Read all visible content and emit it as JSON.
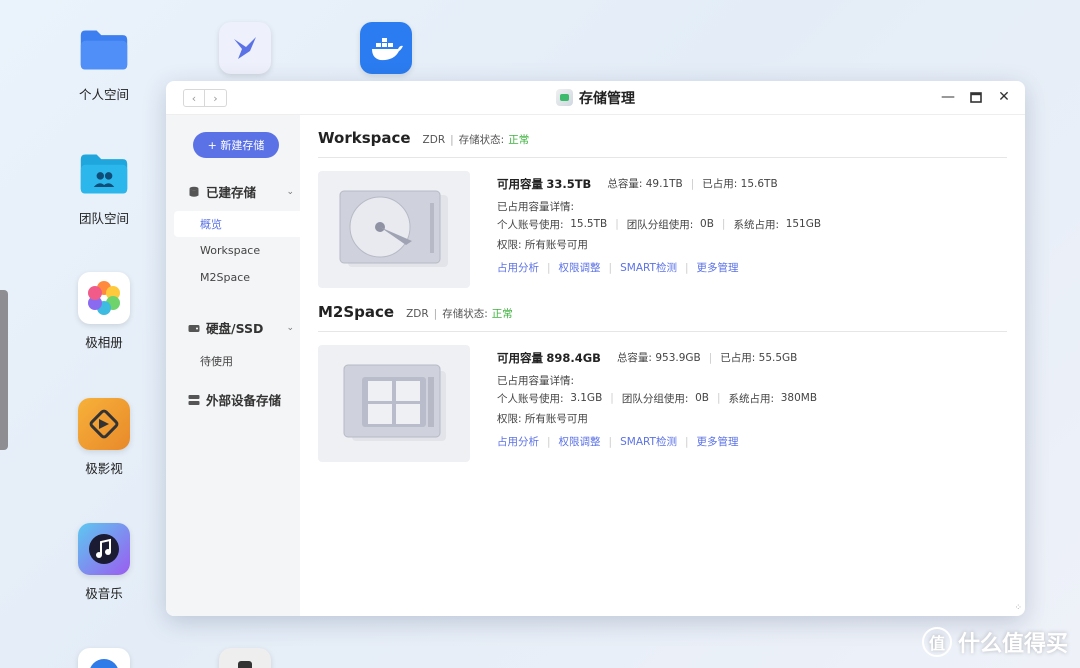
{
  "desktop": {
    "icons": [
      {
        "label": "个人空间",
        "name": "personal-space"
      },
      {
        "label": "团队空间",
        "name": "team-space"
      },
      {
        "label": "极相册",
        "name": "photos"
      },
      {
        "label": "极影视",
        "name": "video"
      },
      {
        "label": "极音乐",
        "name": "music"
      }
    ]
  },
  "window": {
    "title": "存储管理"
  },
  "sidebar": {
    "new_button": "+ 新建存储",
    "groups": [
      {
        "label": "已建存储",
        "items": [
          "概览",
          "Workspace",
          "M2Space"
        ]
      },
      {
        "label": "硬盘/SSD",
        "items": [
          "待使用"
        ]
      },
      {
        "label": "外部设备存储",
        "items": []
      }
    ]
  },
  "volumes": [
    {
      "name": "Workspace",
      "raid": "ZDR",
      "status_label": "存储状态:",
      "status": "正常",
      "available_label": "可用容量",
      "available": "33.5TB",
      "total_label": "总容量:",
      "total": "49.1TB",
      "used_label": "已占用:",
      "used": "15.6TB",
      "detail_label": "已占用容量详情:",
      "personal_label": "个人账号使用:",
      "personal": "15.5TB",
      "team_label": "团队分组使用:",
      "team": "0B",
      "system_label": "系统占用:",
      "system": "151GB",
      "perm_label": "权限:",
      "perm": "所有账号可用",
      "links": [
        "占用分析",
        "权限调整",
        "SMART检测",
        "更多管理"
      ]
    },
    {
      "name": "M2Space",
      "raid": "ZDR",
      "status_label": "存储状态:",
      "status": "正常",
      "available_label": "可用容量",
      "available": "898.4GB",
      "total_label": "总容量:",
      "total": "953.9GB",
      "used_label": "已占用:",
      "used": "55.5GB",
      "detail_label": "已占用容量详情:",
      "personal_label": "个人账号使用:",
      "personal": "3.1GB",
      "team_label": "团队分组使用:",
      "team": "0B",
      "system_label": "系统占用:",
      "system": "380MB",
      "perm_label": "权限:",
      "perm": "所有账号可用",
      "links": [
        "占用分析",
        "权限调整",
        "SMART检测",
        "更多管理"
      ]
    }
  ],
  "watermark": "什么值得买",
  "watermark_icon": "值",
  "colors": {
    "accent": "#5b72e6",
    "ok": "#3eb33e"
  }
}
